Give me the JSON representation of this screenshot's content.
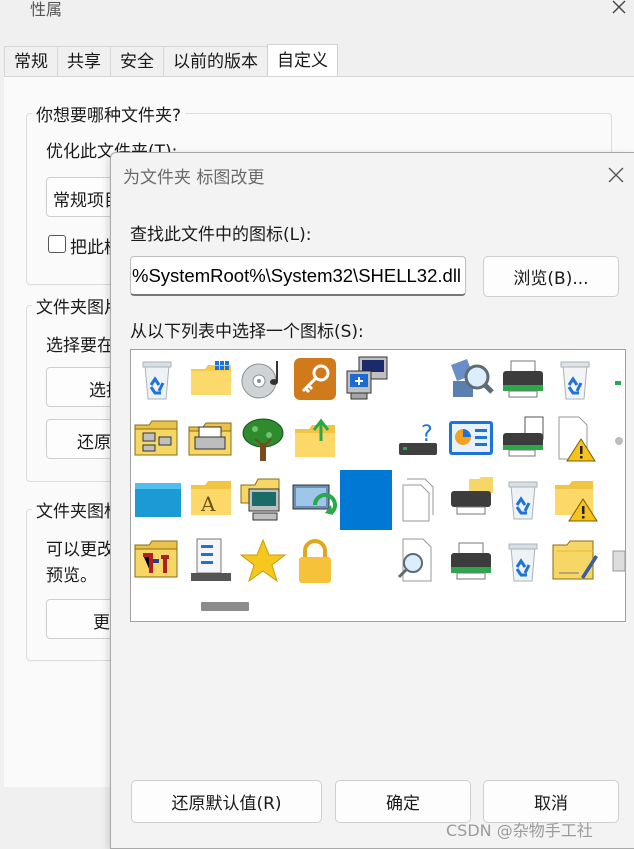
{
  "properties": {
    "title": "性属",
    "tabs": [
      "常规",
      "共享",
      "安全",
      "以前的版本",
      "自定义"
    ],
    "active_tab": "自定义",
    "group1": {
      "label": "你想要哪种文件夹?",
      "optimize_label": "优化此文件夹(T):",
      "optimize_value": "常规项目",
      "checkbox_label": "把此模"
    },
    "group2": {
      "label": "文件夹图片",
      "select_label": "选择要在",
      "btn1": "选择",
      "btn2": "还原"
    },
    "group3": {
      "label": "文件夹图标",
      "text1": "可以更改",
      "text2": "预览。",
      "btn": "更"
    }
  },
  "dialog": {
    "title": "为文件夹 标图改更",
    "find_label": "查找此文件中的图标(L):",
    "path_value": "%SystemRoot%\\System32\\SHELL32.dll",
    "browse_button": "浏览(B)...",
    "list_label": "从以下列表中选择一个图标(S):",
    "restore_button": "还原默认值(R)",
    "ok_button": "确定",
    "cancel_button": "取消"
  },
  "icons": [
    [
      "recycle-bin",
      "folder-grid",
      "cd-music",
      "key-app",
      "network-pc",
      "blank",
      "search-globe",
      "printer",
      "recycle-bin-empty",
      "partial"
    ],
    [
      "folder-network",
      "folder-printer",
      "tree",
      "folder-up-arrow",
      "blank",
      "drive-question",
      "control-panel-chart",
      "fax-printer",
      "document-warning",
      "partial"
    ],
    [
      "blue-panel",
      "folder-font",
      "folder-computer",
      "monitor-sync",
      "blue-square",
      "blank-document",
      "printer-folder",
      "recycle-bin",
      "folder-warning",
      "blank"
    ],
    [
      "folder-tools",
      "server-stack",
      "star",
      "lock",
      "blank",
      "document-search",
      "printer-green",
      "recycle-bin",
      "folder-pen",
      "partial"
    ]
  ],
  "watermark": "CSDN @杂物手工社",
  "colors": {
    "accent": "#0078d4",
    "background": "#f0f0f0",
    "dialog_bg": "#f3f3f3"
  }
}
